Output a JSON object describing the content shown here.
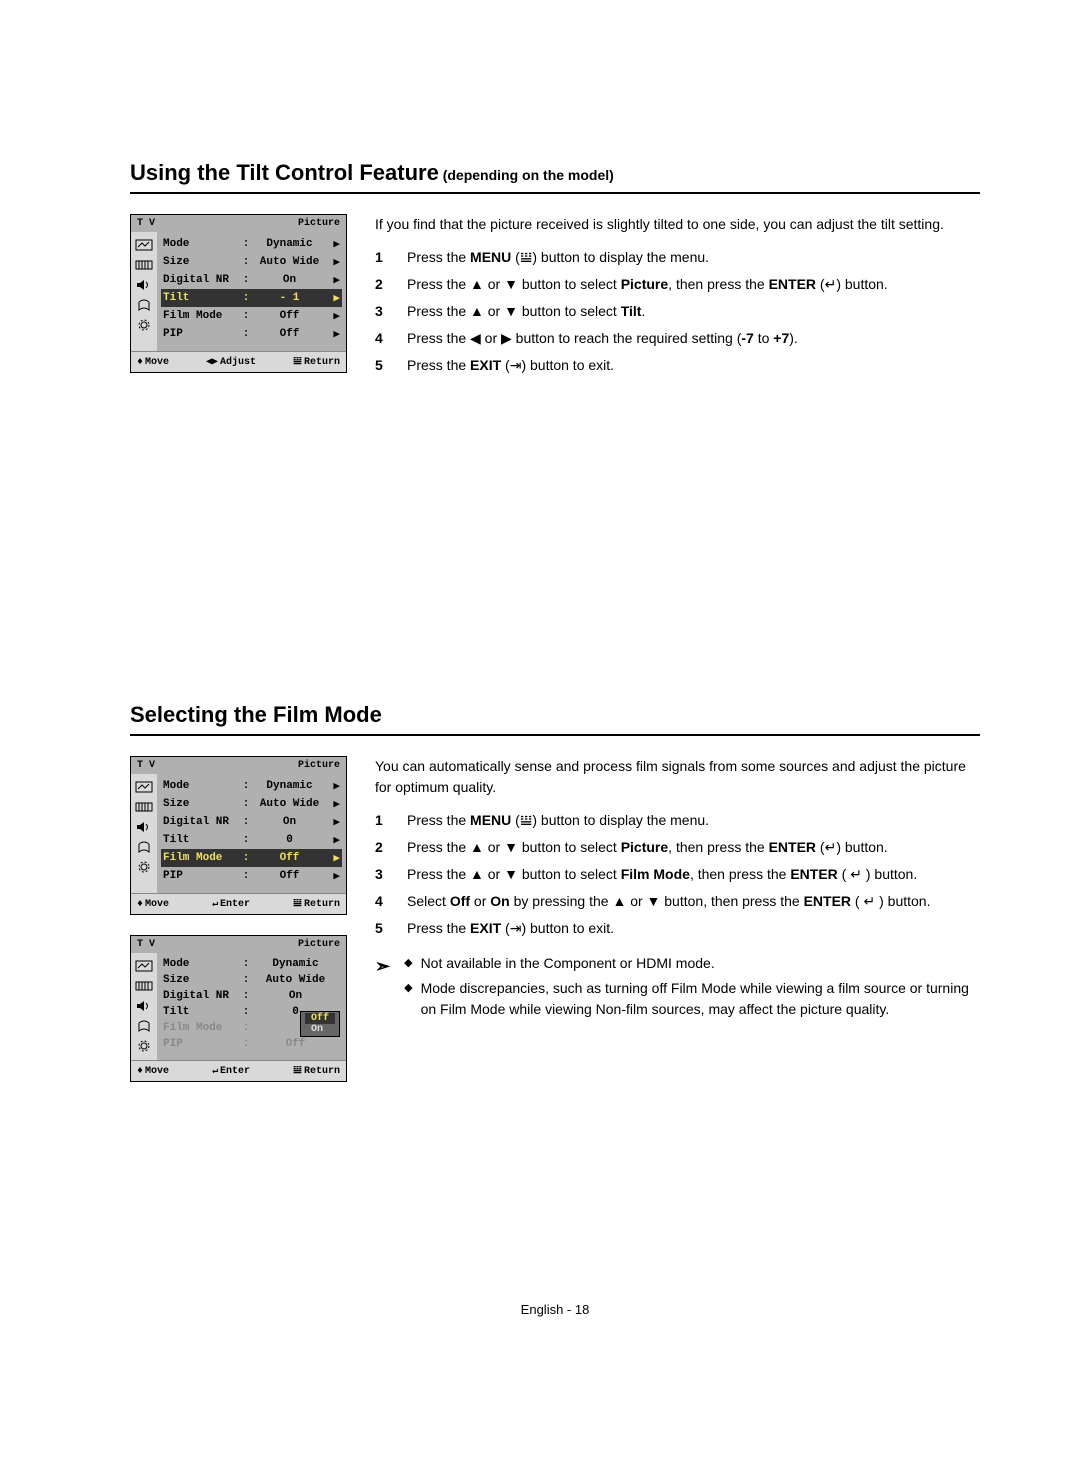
{
  "section1": {
    "title": "Using the Tilt Control Feature",
    "subtitle": " (depending on the model)",
    "intro": "If you find that the picture received is slightly tilted to one side, you can adjust the tilt setting.",
    "steps_pre": {
      "menu": "MENU",
      "picture": "Picture",
      "enter": "ENTER",
      "tilt": "Tilt",
      "range_low": "-7",
      "range_high": "+7",
      "exit": "EXIT"
    },
    "steps": [
      "Press the MENU (𝍎) button to display the menu.",
      "Press the ▲ or ▼ button to select Picture, then press the ENTER (↵) button.",
      "Press the ▲ or ▼ button to select Tilt.",
      "Press the ◀ or ▶ button to reach the required setting (-7 to +7).",
      "Press the EXIT (⇥) button to exit."
    ]
  },
  "section2": {
    "title": "Selecting the Film Mode",
    "intro": "You can automatically sense and process film signals from some sources and adjust the picture for optimum quality.",
    "steps": [
      "Press the MENU (𝍎) button to display the menu.",
      "Press the ▲ or ▼ button to select Picture, then press the ENTER (↵) button.",
      "Press the ▲ or ▼ button to select Film Mode, then press the ENTER ( ↵ ) button.",
      "Select Off or On by pressing the ▲ or ▼ button, then press the ENTER ( ↵ ) button.",
      "Press the EXIT (⇥) button to exit."
    ],
    "notes": [
      "Not available in the Component or HDMI mode.",
      "Mode discrepancies, such as turning off Film Mode while viewing a film source or turning on Film Mode while viewing Non-film sources, may affect the picture quality."
    ]
  },
  "osd": {
    "tv": "T V",
    "menu": "Picture",
    "rows": [
      {
        "label": "Mode",
        "value": "Dynamic"
      },
      {
        "label": "Size",
        "value": "Auto Wide"
      },
      {
        "label": "Digital NR",
        "value": "On"
      },
      {
        "label": "Tilt",
        "value_tilt": "- 1",
        "value_zero": "0"
      },
      {
        "label": "Film Mode",
        "value": "Off"
      },
      {
        "label": "PIP",
        "value": "Off"
      }
    ],
    "dropdown": {
      "off": "Off",
      "on": "On"
    },
    "footer": {
      "move": "Move",
      "adjust": "Adjust",
      "enter": "Enter",
      "return": "Return"
    }
  },
  "page_footer": "English - 18"
}
